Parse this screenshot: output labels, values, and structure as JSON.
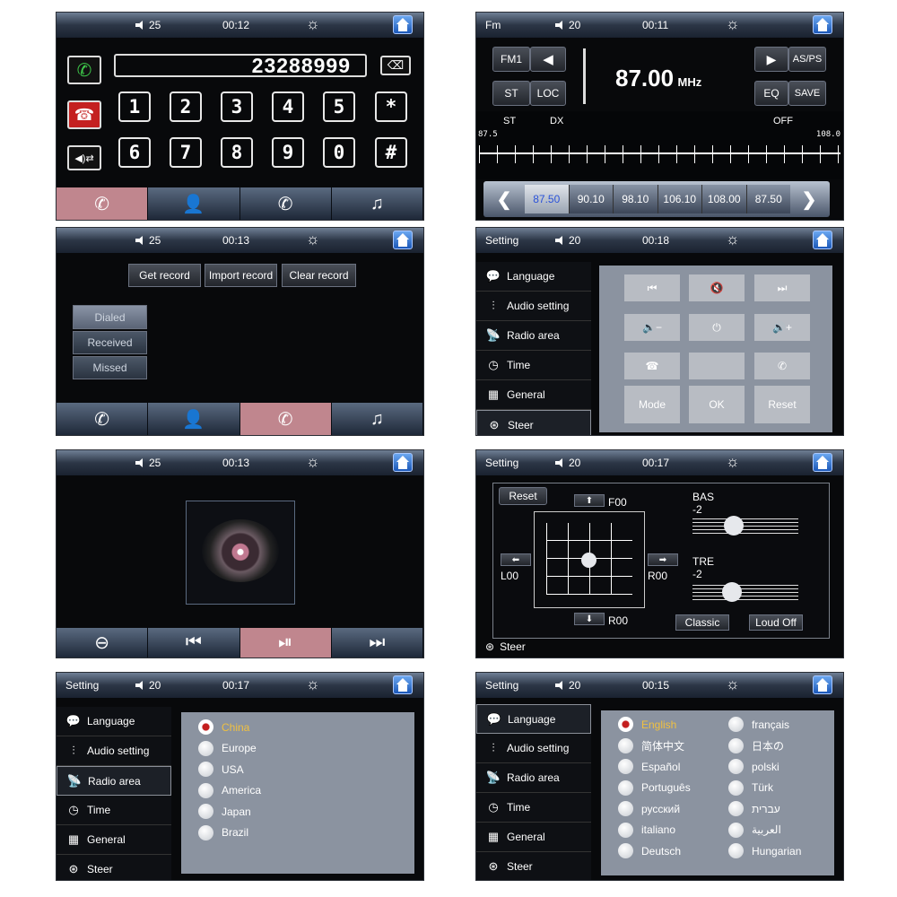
{
  "phone": {
    "volume": "25",
    "time": "00:12",
    "dial_number": "23288999",
    "keys_row1": [
      "1",
      "2",
      "3",
      "4",
      "5",
      "*"
    ],
    "keys_row2": [
      "6",
      "7",
      "8",
      "9",
      "0",
      "#"
    ]
  },
  "radio": {
    "title": "Fm",
    "volume": "20",
    "time": "00:11",
    "band": "FM1",
    "st": "ST",
    "loc": "LOC",
    "frequency": "87.00",
    "unit": "MHz",
    "asps": "AS/PS",
    "eq": "EQ",
    "save": "SAVE",
    "st_ind": "ST",
    "dx_ind": "DX",
    "off_ind": "OFF",
    "scale_min": "87.5",
    "scale_max": "108.0",
    "presets": [
      "87.50",
      "90.10",
      "98.10",
      "106.10",
      "108.00",
      "87.50"
    ],
    "active_preset_color": "#2a52d8"
  },
  "records": {
    "volume": "25",
    "time": "00:13",
    "get": "Get record",
    "import": "Import record",
    "clear": "Clear record",
    "filters": [
      "Dialed",
      "Received",
      "Missed"
    ]
  },
  "steer": {
    "title": "Setting",
    "volume": "20",
    "time": "00:18",
    "menu": [
      "Language",
      "Audio setting",
      "Radio area",
      "Time",
      "General",
      "Steer"
    ],
    "buttons": [
      "⏮",
      "🔇",
      "⏭",
      "🔉−",
      "⏻",
      "🔊+",
      "☎",
      "",
      "✆",
      "Mode",
      "OK",
      "Reset"
    ]
  },
  "music": {
    "volume": "25",
    "time": "00:13"
  },
  "audio": {
    "title": "Setting",
    "volume": "20",
    "time": "00:17",
    "reset": "Reset",
    "f_label": "F00",
    "l_label": "L00",
    "r_label": "R00",
    "r2_label": "R00",
    "bas_label": "BAS",
    "bas_value": "-2",
    "tre_label": "TRE",
    "tre_value": "-2",
    "classic": "Classic",
    "loud": "Loud Off",
    "steer_item": "Steer"
  },
  "area": {
    "title": "Setting",
    "volume": "20",
    "time": "00:17",
    "menu": [
      "Language",
      "Audio setting",
      "Radio area",
      "Time",
      "General",
      "Steer"
    ],
    "regions": [
      "China",
      "Europe",
      "USA",
      "America",
      "Japan",
      "Brazil"
    ],
    "selected": "China"
  },
  "lang": {
    "title": "Setting",
    "volume": "20",
    "time": "00:15",
    "menu": [
      "Language",
      "Audio setting",
      "Radio area",
      "Time",
      "General",
      "Steer"
    ],
    "col1": [
      "English",
      "简体中文",
      "Español",
      "Português",
      "русский",
      "italiano",
      "Deutsch"
    ],
    "col2": [
      "français",
      "日本の",
      "polski",
      "Türk",
      "עברית",
      "العربية",
      "Hungarian"
    ]
  }
}
